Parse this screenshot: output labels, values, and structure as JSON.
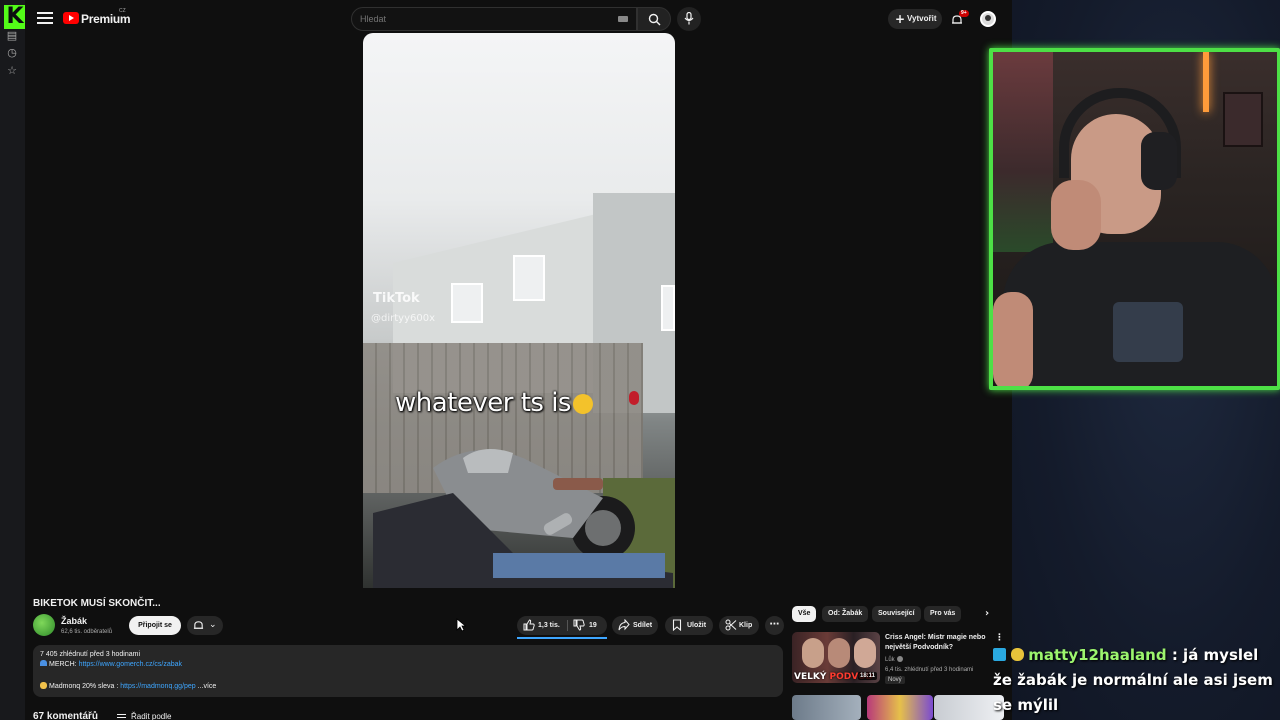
{
  "header": {
    "logo_text": "Premium",
    "region": "CZ",
    "search_placeholder": "Hledat",
    "create_label": "Vytvořit",
    "notification_badge": "9+"
  },
  "video": {
    "tiktok_logo": "TikTok",
    "tiktok_user": "@dirtyy600x",
    "caption": "whatever ts is"
  },
  "info": {
    "title": "BIKETOK MUSÍ SKONČIT...",
    "channel_name": "Žabák",
    "subscribers": "62,6 tis. odběratelů",
    "join_label": "Připojit se",
    "likes": "1,3 tis.",
    "dislikes": "19",
    "share_label": "Sdílet",
    "save_label": "Uložit",
    "clip_label": "Klip"
  },
  "description": {
    "stats": "7 405 zhlédnutí  před 3 hodinami",
    "merch_label": "MERCH: ",
    "merch_url": "https://www.gomerch.cz/cs/zabak",
    "promo_label": "Madmonq 20% sleva : ",
    "promo_url": "https://madmonq.gg/pep",
    "more_label": "...více"
  },
  "comments": {
    "count_label": "67 komentářů",
    "sort_label": "Řadit podle"
  },
  "chips": [
    "Vše",
    "Od: Žabák",
    "Související",
    "Pro vás"
  ],
  "recommendation": {
    "title": "Criss Angel: Mistr magie nebo největší Podvodník?",
    "channel": "Lůk",
    "meta": "6,4 tis. zhlédnutí  před 3 hodinami",
    "badge": "Nový",
    "duration": "18:11",
    "thumb_text_1": "VELKÝ",
    "thumb_text_2": "PODVOD"
  },
  "chat": {
    "username": "matty12haaland",
    "message": "já myslel že žabák je normální ale asi jsem se mýlil"
  },
  "colors": {
    "kick_green": "#53fc18",
    "youtube_red": "#ff0000",
    "link_blue": "#3ea6ff",
    "webcam_border": "#4de046",
    "chat_username": "#9cf56e"
  }
}
